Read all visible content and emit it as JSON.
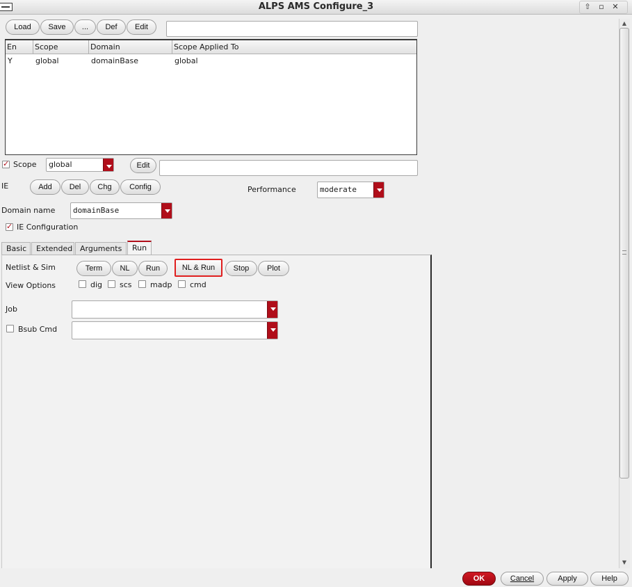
{
  "window": {
    "title": "ALPS AMS Configure_3",
    "controls": [
      "⇧",
      "▫",
      "✕"
    ]
  },
  "toolbar": {
    "load": "Load",
    "save": "Save",
    "more": "...",
    "def": "Def",
    "edit": "Edit",
    "text_value": ""
  },
  "table": {
    "columns": [
      "En",
      "Scope",
      "Domain",
      "Scope Applied To"
    ],
    "rows": [
      [
        "Y",
        "global",
        "domainBase",
        "global"
      ]
    ]
  },
  "scope": {
    "checked": true,
    "label": "Scope",
    "value": "global",
    "edit": "Edit",
    "text_value": ""
  },
  "ie": {
    "label": "IE",
    "add": "Add",
    "del": "Del",
    "chg": "Chg",
    "config": "Config"
  },
  "performance": {
    "label": "Performance",
    "value": "moderate"
  },
  "domain": {
    "label": "Domain name",
    "value": "domainBase"
  },
  "ie_configuration": {
    "checked": true,
    "label": "IE Configuration"
  },
  "tabs": [
    {
      "label": "Basic",
      "active": false
    },
    {
      "label": "Extended",
      "active": false
    },
    {
      "label": "Arguments",
      "active": false
    },
    {
      "label": "Run",
      "active": true
    }
  ],
  "run": {
    "netlist_label": "Netlist & Sim",
    "buttons": [
      "Term",
      "NL",
      "Run",
      "NL & Run",
      "Stop",
      "Plot"
    ],
    "view_label": "View Options",
    "view_options": [
      {
        "label": "dig",
        "checked": false
      },
      {
        "label": "scs",
        "checked": false
      },
      {
        "label": "madp",
        "checked": false
      },
      {
        "label": "cmd",
        "checked": false
      }
    ],
    "job_label": "Job",
    "job_value": "",
    "bsub_label": "Bsub Cmd",
    "bsub_checked": false,
    "bsub_value": ""
  },
  "footer": {
    "ok": "OK",
    "cancel": "Cancel",
    "apply": "Apply",
    "help": "Help"
  },
  "colors": {
    "accent": "#b00e1a",
    "highlight": "#e01f1f"
  }
}
